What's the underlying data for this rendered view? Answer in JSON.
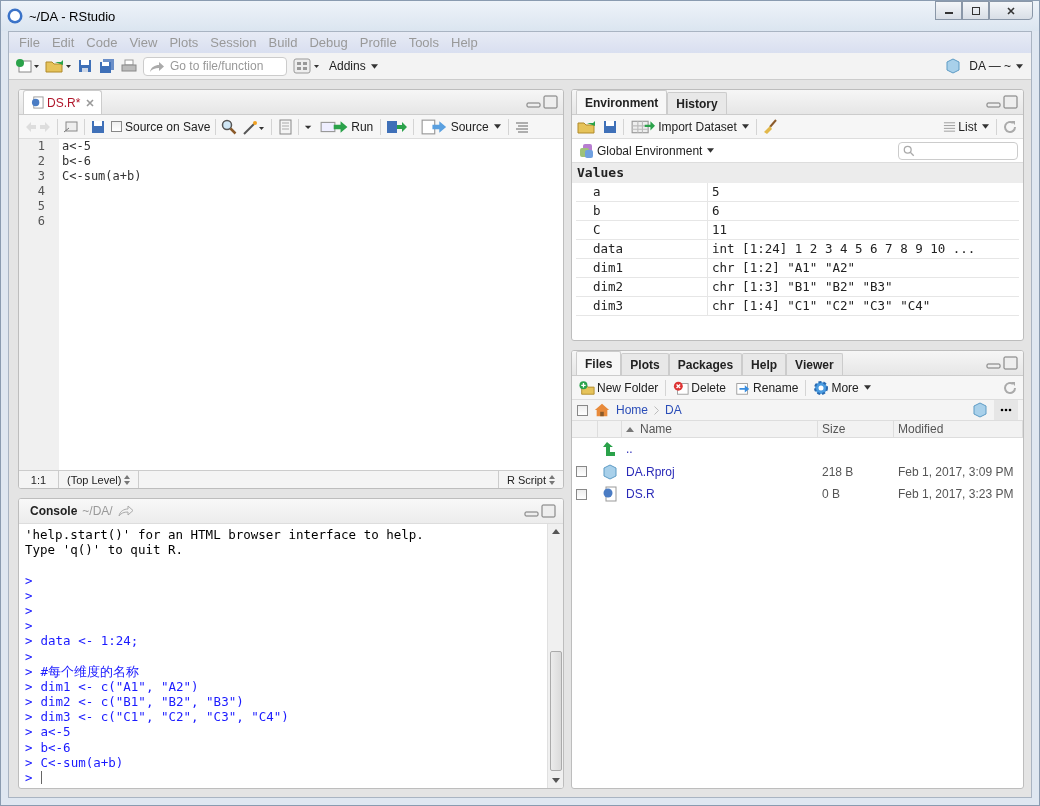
{
  "window": {
    "title": "~/DA - RStudio"
  },
  "menu": [
    "File",
    "Edit",
    "Code",
    "View",
    "Plots",
    "Session",
    "Build",
    "Debug",
    "Profile",
    "Tools",
    "Help"
  ],
  "toolbar": {
    "goto_placeholder": "Go to file/function",
    "addins": "Addins",
    "project": "DA — ~"
  },
  "editor": {
    "tabs": [
      {
        "label": "DS.R*",
        "selected": true
      }
    ],
    "source_on_save": {
      "label": "Source on Save",
      "checked": false
    },
    "run": "Run",
    "source": "Source",
    "lines": [
      {
        "number": "1",
        "code": "a<-5"
      },
      {
        "number": "2",
        "code": "b<-6"
      },
      {
        "number": "3",
        "code": "C<-sum(a+b)"
      },
      {
        "number": "4"
      },
      {
        "number": "5"
      },
      {
        "number": "6"
      }
    ],
    "status": {
      "position": "1:1",
      "scope": "(Top Level)",
      "file_type": "R Script"
    }
  },
  "console": {
    "title": "Console",
    "path": "~/DA/",
    "lines": [
      {
        "kind": "output",
        "text": "'help.start()' for an HTML browser interface to help."
      },
      {
        "kind": "output",
        "text": "Type 'q()' to quit R."
      },
      {
        "kind": "blank"
      },
      {
        "kind": "input",
        "prompt": ">"
      },
      {
        "kind": "input",
        "prompt": ">"
      },
      {
        "kind": "input",
        "prompt": ">"
      },
      {
        "kind": "input",
        "prompt": ">"
      },
      {
        "kind": "input",
        "prompt": ">",
        "code": "data <- 1:24;"
      },
      {
        "kind": "input",
        "prompt": ">"
      },
      {
        "kind": "input",
        "prompt": ">",
        "code": "#每个维度的名称"
      },
      {
        "kind": "input",
        "prompt": ">",
        "code": "dim1 <- c(\"A1\", \"A2\")"
      },
      {
        "kind": "input",
        "prompt": ">",
        "code": "dim2 <- c(\"B1\", \"B2\", \"B3\")"
      },
      {
        "kind": "input",
        "prompt": ">",
        "code": "dim3 <- c(\"C1\", \"C2\", \"C3\", \"C4\")"
      },
      {
        "kind": "input",
        "prompt": ">",
        "code": "a<-5"
      },
      {
        "kind": "input",
        "prompt": ">",
        "code": "b<-6"
      },
      {
        "kind": "input",
        "prompt": ">",
        "code": "C<-sum(a+b)"
      },
      {
        "kind": "active",
        "prompt": ">"
      }
    ]
  },
  "environment": {
    "tabs": [
      {
        "label": "Environment",
        "selected": true
      },
      {
        "label": "History",
        "selected": false
      }
    ],
    "import": "Import Dataset",
    "view": "List",
    "scope": "Global Environment",
    "section": "Values",
    "rows": [
      {
        "name": "a",
        "value": "5"
      },
      {
        "name": "b",
        "value": "6"
      },
      {
        "name": "C",
        "value": "11"
      },
      {
        "name": "data",
        "value": "int [1:24] 1 2 3 4 5 6 7 8 9 10 ..."
      },
      {
        "name": "dim1",
        "value": "chr [1:2] \"A1\" \"A2\""
      },
      {
        "name": "dim2",
        "value": "chr [1:3] \"B1\" \"B2\" \"B3\""
      },
      {
        "name": "dim3",
        "value": "chr [1:4] \"C1\" \"C2\" \"C3\" \"C4\""
      }
    ]
  },
  "files": {
    "tabs": [
      {
        "label": "Files",
        "selected": true
      },
      {
        "label": "Plots",
        "selected": false
      },
      {
        "label": "Packages",
        "selected": false
      },
      {
        "label": "Help",
        "selected": false
      },
      {
        "label": "Viewer",
        "selected": false
      }
    ],
    "actions": [
      "New Folder",
      "Delete",
      "Rename",
      "More"
    ],
    "select_all_checked": false,
    "breadcrumb": [
      "Home",
      "DA"
    ],
    "columns": [
      "Name",
      "Size",
      "Modified"
    ],
    "rows": [
      {
        "kind": "up",
        "name": ".."
      },
      {
        "kind": "rproj",
        "name": "DA.Rproj",
        "size": "218 B",
        "modified": "Feb 1, 2017, 3:09 PM",
        "checked": false
      },
      {
        "kind": "rfile",
        "name": "DS.R",
        "size": "0 B",
        "modified": "Feb 1, 2017, 3:23 PM",
        "checked": false
      }
    ]
  }
}
